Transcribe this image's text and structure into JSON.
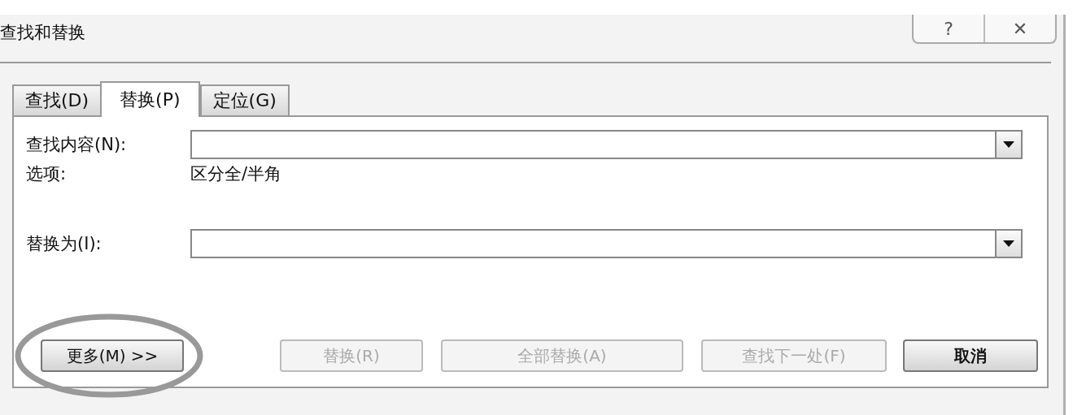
{
  "window": {
    "title": "查找和替换",
    "help": "?",
    "close": "✕"
  },
  "tabs": [
    {
      "label": "查找(D)",
      "selected": false
    },
    {
      "label": "替换(P)",
      "selected": true
    },
    {
      "label": "定位(G)",
      "selected": false
    }
  ],
  "find": {
    "label": "查找内容(N):",
    "options_label": "选项:",
    "options_value": "区分全/半角"
  },
  "replace": {
    "label": "替换为(I):"
  },
  "buttons": [
    {
      "label": "更多(M) >>",
      "disabled": false,
      "circled": true,
      "bold": false
    },
    {
      "label": "替换(R)",
      "disabled": true,
      "circled": false,
      "bold": false
    },
    {
      "label": "全部替换(A)",
      "disabled": true,
      "circled": false,
      "bold": false
    },
    {
      "label": "查找下一处(F)",
      "disabled": true,
      "circled": false,
      "bold": false
    },
    {
      "label": "取消",
      "disabled": false,
      "circled": false,
      "bold": true
    }
  ]
}
